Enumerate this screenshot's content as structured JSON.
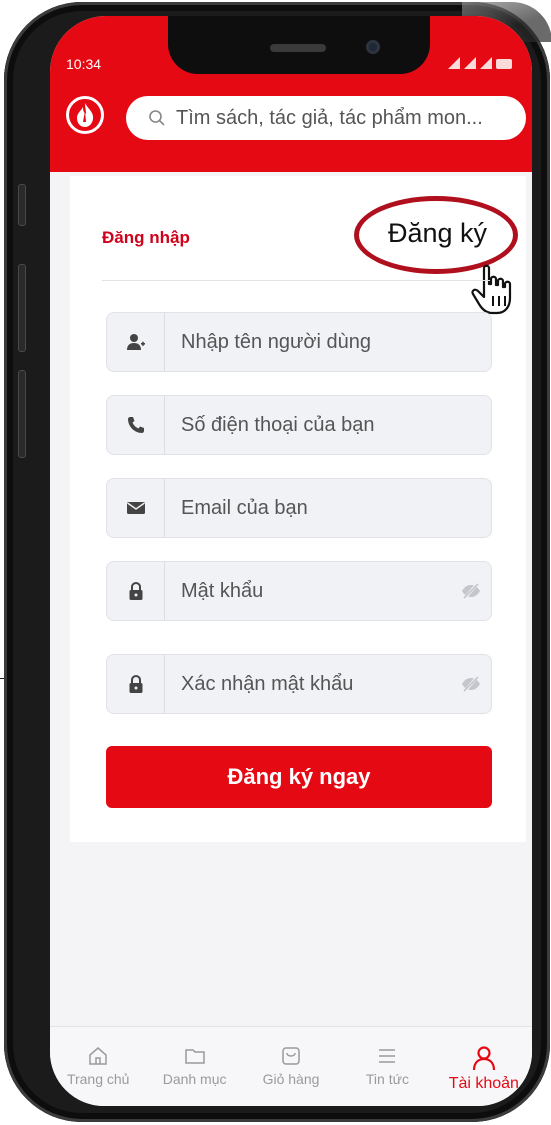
{
  "status_bar": {
    "time": "10:34"
  },
  "search": {
    "placeholder": "Tìm sách, tác giả, tác phẩm mon..."
  },
  "auth_tabs": {
    "login": "Đăng nhập",
    "register": "Đăng ký",
    "active": "register"
  },
  "form": {
    "fields": [
      {
        "placeholder": "Nhập tên người dùng",
        "icon": "user-plus-icon"
      },
      {
        "placeholder": "Số điện thoại của bạn",
        "icon": "phone-icon"
      },
      {
        "placeholder": "Email của bạn",
        "icon": "envelope-icon"
      },
      {
        "placeholder": "Mật khẩu",
        "icon": "lock-icon",
        "toggle": "eye-slash-icon"
      },
      {
        "placeholder": "Xác nhận mật khẩu",
        "icon": "lock-icon",
        "toggle": "eye-slash-icon"
      }
    ],
    "submit_label": "Đăng ký ngay"
  },
  "bottom_nav": {
    "items": [
      {
        "label": "Trang chủ",
        "icon": "home-icon"
      },
      {
        "label": "Danh mục",
        "icon": "folder-icon"
      },
      {
        "label": "Giỏ hàng",
        "icon": "cart-icon"
      },
      {
        "label": "Tin tức",
        "icon": "list-icon"
      },
      {
        "label": "Tài khoản",
        "icon": "user-icon",
        "active": true
      }
    ]
  },
  "colors": {
    "brand": "#e50914",
    "highlight": "#b0101d"
  }
}
